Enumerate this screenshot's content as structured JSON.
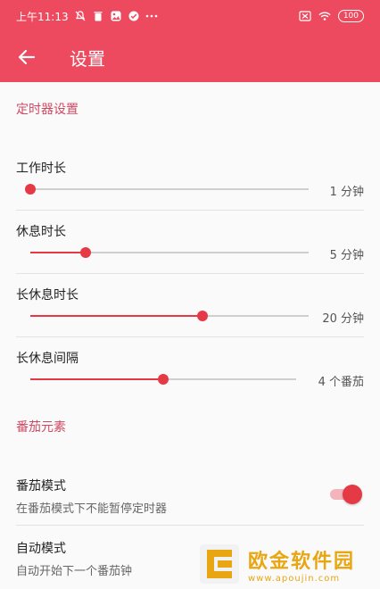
{
  "status_bar": {
    "time": "上午11:13",
    "battery": "100"
  },
  "app_bar": {
    "title": "设置"
  },
  "timer_section": {
    "header": "定时器设置",
    "items": [
      {
        "label": "工作时长",
        "value": 1,
        "value_text": "1 分钟",
        "fraction": 0.0
      },
      {
        "label": "休息时长",
        "value": 5,
        "value_text": "5 分钟",
        "fraction": 0.2
      },
      {
        "label": "长休息时长",
        "value": 20,
        "value_text": "20 分钟",
        "fraction": 0.62
      },
      {
        "label": "长休息间隔",
        "value": 4,
        "value_text": "4 个番茄",
        "fraction": 0.5
      }
    ]
  },
  "tomato_section": {
    "header": "番茄元素",
    "items": [
      {
        "title": "番茄模式",
        "subtitle": "在番茄模式下不能暂停定时器",
        "enabled": true
      },
      {
        "title": "自动模式",
        "subtitle": "自动开始下一个番茄钟"
      }
    ]
  },
  "watermark": {
    "main": "欧金软件园",
    "sub": "www.apoujin.com"
  },
  "colors": {
    "primary": "#ee4a5f",
    "accent": "#e53a45",
    "section_header": "#cc4a63",
    "track": "#cfcfcf"
  }
}
